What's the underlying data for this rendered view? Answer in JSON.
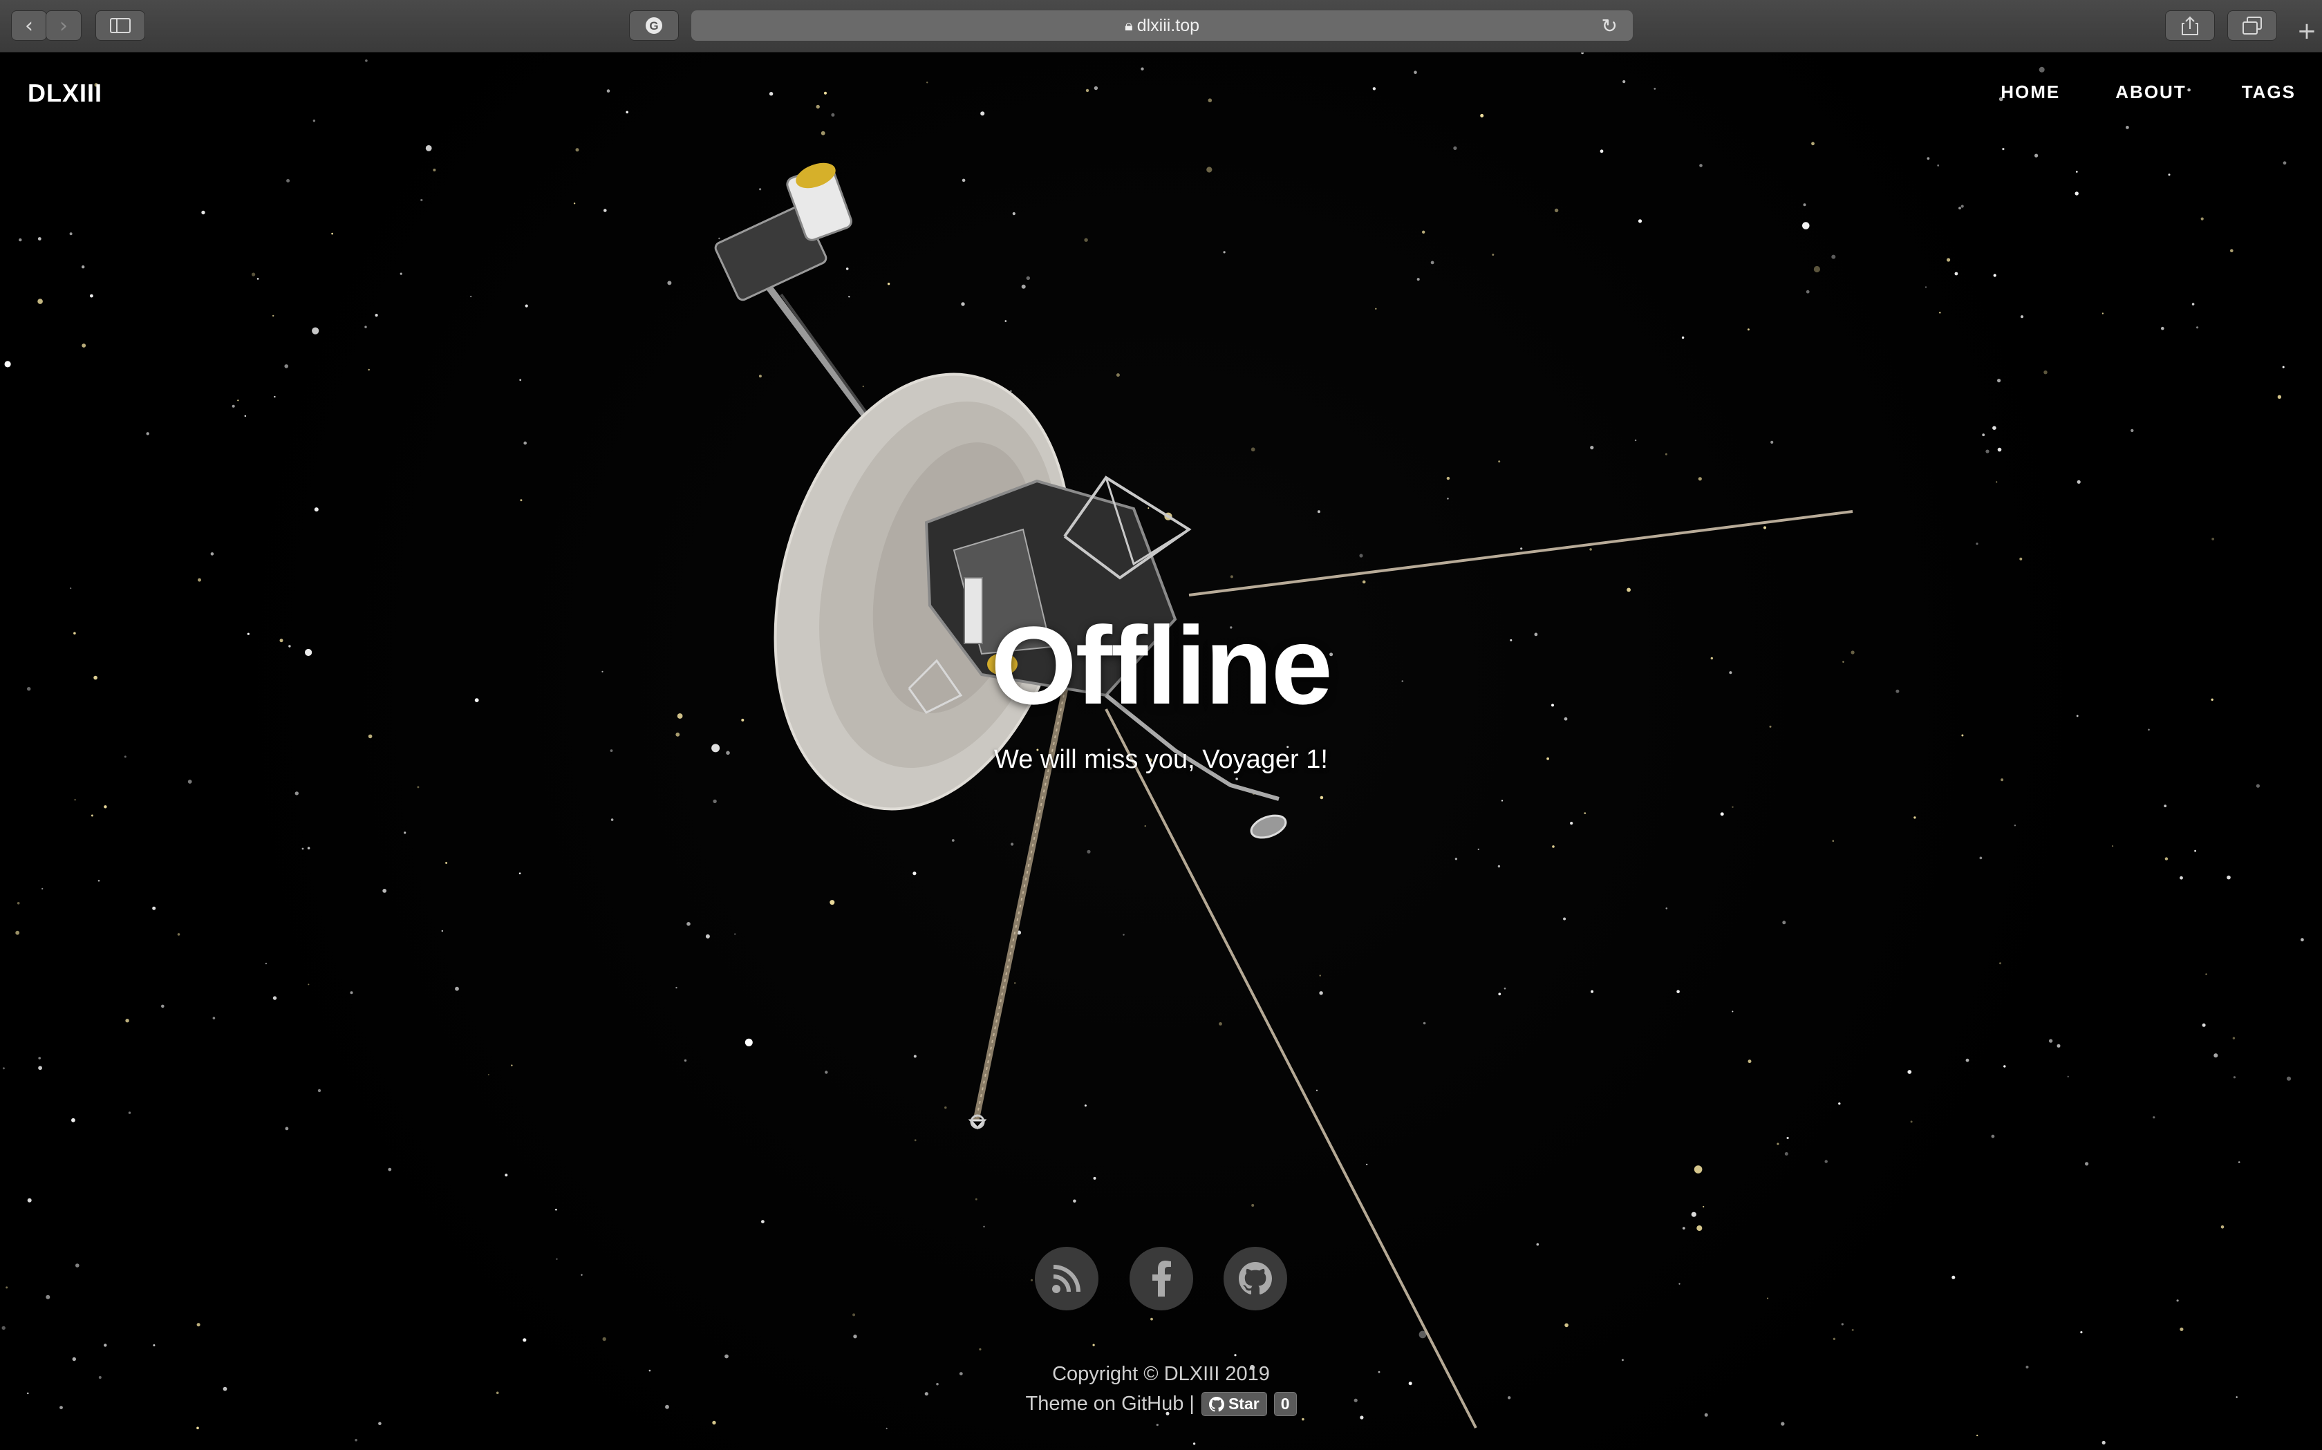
{
  "browser": {
    "url": "dlxiii.top",
    "icons": {
      "back": "chevron-left-icon",
      "forward": "chevron-right-icon",
      "sidebar": "sidebar-icon",
      "grammarly": "grammarly-icon",
      "lock": "lock-icon",
      "reload": "reload-icon",
      "share": "share-icon",
      "tabs": "tabs-overview-icon",
      "new_tab": "plus-icon"
    }
  },
  "site": {
    "brand": "DLXIII",
    "nav": [
      "HOME",
      "ABOUT",
      "TAGS"
    ]
  },
  "hero": {
    "title": "Offline",
    "subtitle": "We will miss you, Voyager 1!"
  },
  "social": {
    "icons": [
      "rss-icon",
      "facebook-icon",
      "github-icon"
    ]
  },
  "footer": {
    "copyright": "Copyright © DLXIII 2019",
    "theme": "Theme on GitHub |",
    "star_label": "Star",
    "star_count": "0"
  },
  "colors": {
    "background": "#000000",
    "text": "#ffffff",
    "footer_text": "#cfcfcf",
    "social_bg": "#3a3a3a"
  }
}
